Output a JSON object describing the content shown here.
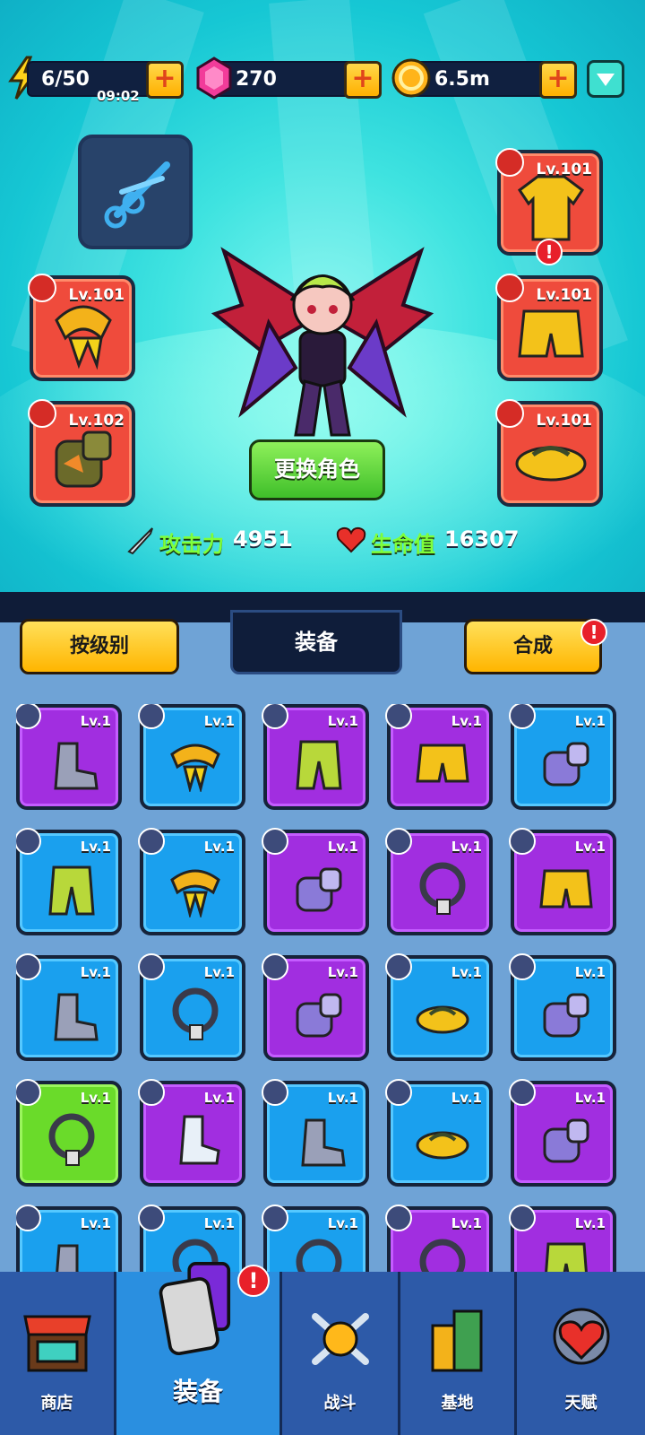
{
  "resources": {
    "energy": "6/50",
    "energy_timer": "09:02",
    "gems": "270",
    "gold": "6.5m"
  },
  "hero": {
    "change_character_label": "更换角色",
    "attack_label": "攻击力",
    "attack_value": "4951",
    "hp_label": "生命值",
    "hp_value": "16307"
  },
  "equipped": {
    "necklace_lv": "Lv.101",
    "glove_lv": "Lv.102",
    "armor_lv": "Lv.101",
    "pants_lv": "Lv.101",
    "shoes_lv": "Lv.101"
  },
  "inventory_header": {
    "sort_label": "按级别",
    "title": "装备",
    "merge_label": "合成",
    "merge_alert": "!"
  },
  "inventory": [
    {
      "lv": "Lv.1",
      "rarity": "purple",
      "icon": "boot-icon"
    },
    {
      "lv": "Lv.1",
      "rarity": "blue",
      "icon": "scarf-icon"
    },
    {
      "lv": "Lv.1",
      "rarity": "purple",
      "icon": "pants-icon"
    },
    {
      "lv": "Lv.1",
      "rarity": "purple",
      "icon": "shorts-icon"
    },
    {
      "lv": "Lv.1",
      "rarity": "blue",
      "icon": "glove-icon"
    },
    {
      "lv": "Lv.1",
      "rarity": "blue",
      "icon": "pants-icon"
    },
    {
      "lv": "Lv.1",
      "rarity": "blue",
      "icon": "scarf-icon"
    },
    {
      "lv": "Lv.1",
      "rarity": "purple",
      "icon": "glove-icon"
    },
    {
      "lv": "Lv.1",
      "rarity": "purple",
      "icon": "necklace-icon"
    },
    {
      "lv": "Lv.1",
      "rarity": "purple",
      "icon": "shorts-icon"
    },
    {
      "lv": "Lv.1",
      "rarity": "blue",
      "icon": "boot-icon"
    },
    {
      "lv": "Lv.1",
      "rarity": "blue",
      "icon": "necklace-icon"
    },
    {
      "lv": "Lv.1",
      "rarity": "purple",
      "icon": "glove-icon"
    },
    {
      "lv": "Lv.1",
      "rarity": "blue",
      "icon": "sandal-icon"
    },
    {
      "lv": "Lv.1",
      "rarity": "blue",
      "icon": "glove-icon"
    },
    {
      "lv": "Lv.1",
      "rarity": "green",
      "icon": "necklace-icon"
    },
    {
      "lv": "Lv.1",
      "rarity": "purple",
      "icon": "sock-icon"
    },
    {
      "lv": "Lv.1",
      "rarity": "blue",
      "icon": "boot-icon"
    },
    {
      "lv": "Lv.1",
      "rarity": "blue",
      "icon": "sandal-icon"
    },
    {
      "lv": "Lv.1",
      "rarity": "purple",
      "icon": "glove-icon"
    },
    {
      "lv": "Lv.1",
      "rarity": "blue",
      "icon": "boot-icon"
    },
    {
      "lv": "Lv.1",
      "rarity": "blue",
      "icon": "necklace-icon"
    },
    {
      "lv": "Lv.1",
      "rarity": "blue",
      "icon": "necklace-icon"
    },
    {
      "lv": "Lv.1",
      "rarity": "purple",
      "icon": "necklace-icon"
    },
    {
      "lv": "Lv.1",
      "rarity": "purple",
      "icon": "pants-icon"
    }
  ],
  "nav": {
    "shop": "商店",
    "equip": "装备",
    "battle": "战斗",
    "base": "基地",
    "talent": "天赋",
    "equip_alert": "!"
  },
  "colors": {
    "hero_bg": "#3fe3e0",
    "slot_red": "#ef4b3c",
    "rarity_purple": "#a12ee0",
    "rarity_blue": "#1aa0ee",
    "rarity_green": "#6adb2a",
    "button_yellow": "#ffc21a",
    "button_green": "#5ad23a"
  }
}
